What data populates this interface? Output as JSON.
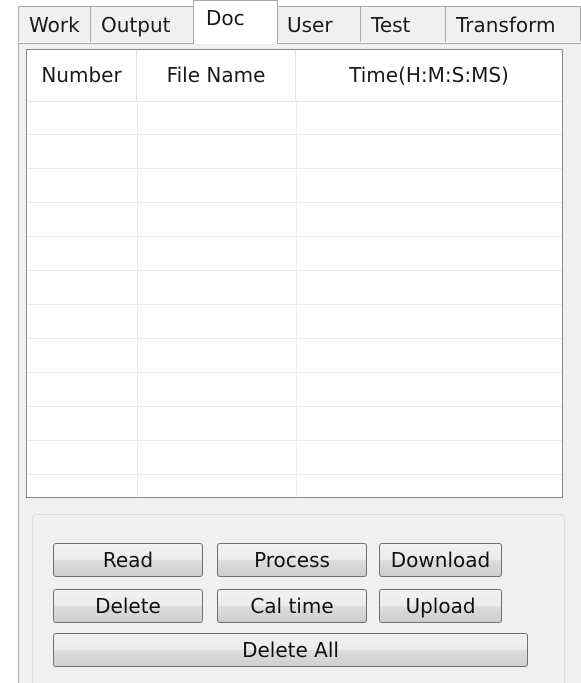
{
  "tabs": [
    {
      "label": "Work"
    },
    {
      "label": "Output"
    },
    {
      "label": "Doc",
      "active": true
    },
    {
      "label": "User"
    },
    {
      "label": "Test"
    },
    {
      "label": "Transform"
    }
  ],
  "file_list": {
    "columns": [
      "Number",
      "File Name",
      "Time(H:M:S:MS)"
    ],
    "rows": []
  },
  "buttons": {
    "read": "Read",
    "process": "Process",
    "download": "Download",
    "delete": "Delete",
    "cal_time": "Cal time",
    "upload": "Upload",
    "delete_all": "Delete All"
  }
}
